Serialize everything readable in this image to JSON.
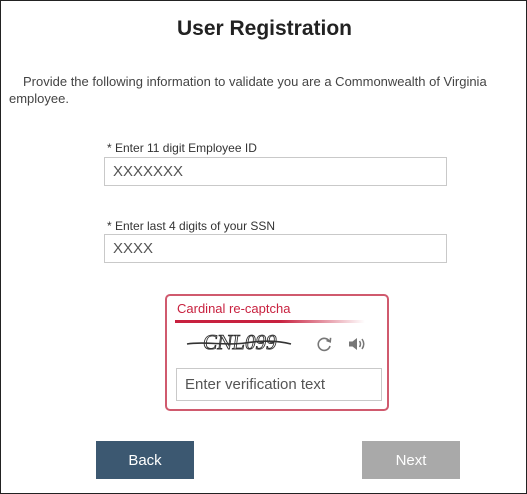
{
  "page": {
    "title": "User Registration",
    "intro": "Provide the following information to validate you are a Commonwealth of Virginia employee."
  },
  "form": {
    "employee_id_label": "* Enter 11 digit Employee ID",
    "employee_id_placeholder": "XXXXXXX",
    "ssn_label": "* Enter last 4 digits of your SSN",
    "ssn_placeholder": "XXXX"
  },
  "captcha": {
    "title": "Cardinal re-captcha",
    "image_text": "CNL099",
    "input_placeholder": "Enter verification text",
    "refresh_icon": "refresh-icon",
    "audio_icon": "speaker-icon",
    "accent_color": "#c8213f"
  },
  "buttons": {
    "back_label": "Back",
    "next_label": "Next"
  },
  "colors": {
    "back_button": "#3c5871",
    "next_button_disabled": "#a9a9a9"
  }
}
